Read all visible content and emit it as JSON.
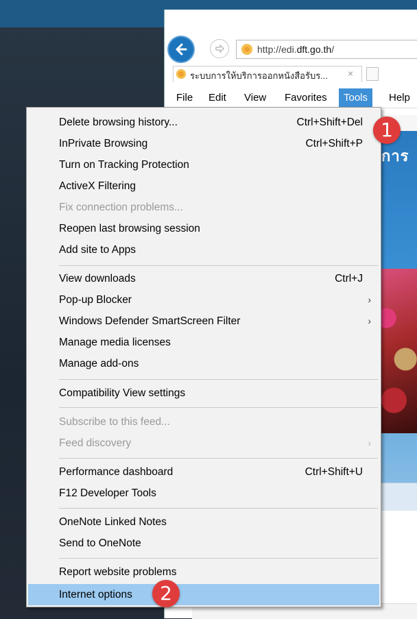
{
  "browser": {
    "url_prefix": "http://edi.",
    "url_domain": "dft.go.th",
    "url_suffix": "/",
    "tab_title": "ระบบการให้บริการออกหนังสือรับร...",
    "tab_close": "×"
  },
  "menubar": {
    "items": [
      "File",
      "Edit",
      "View",
      "Favorites",
      "Tools",
      "Help"
    ],
    "active": "Tools"
  },
  "page": {
    "banner_text": "การ"
  },
  "tools_menu": {
    "items": [
      {
        "label": "Delete browsing history...",
        "shortcut": "Ctrl+Shift+Del"
      },
      {
        "label": "InPrivate Browsing",
        "shortcut": "Ctrl+Shift+P"
      },
      {
        "label": "Turn on Tracking Protection"
      },
      {
        "label": "ActiveX Filtering"
      },
      {
        "label": "Fix connection problems...",
        "disabled": true
      },
      {
        "label": "Reopen last browsing session"
      },
      {
        "label": "Add site to Apps"
      },
      {
        "label": "View downloads",
        "shortcut": "Ctrl+J"
      },
      {
        "label": "Pop-up Blocker",
        "submenu": true
      },
      {
        "label": "Windows Defender SmartScreen Filter",
        "submenu": true
      },
      {
        "label": "Manage media licenses"
      },
      {
        "label": "Manage add-ons"
      },
      {
        "label": "Compatibility View settings"
      },
      {
        "label": "Subscribe to this feed...",
        "disabled": true
      },
      {
        "label": "Feed discovery",
        "disabled": true,
        "submenu": true
      },
      {
        "label": "Performance dashboard",
        "shortcut": "Ctrl+Shift+U"
      },
      {
        "label": "F12 Developer Tools"
      },
      {
        "label": "OneNote Linked Notes"
      },
      {
        "label": "Send to OneNote"
      },
      {
        "label": "Report website problems"
      },
      {
        "label": "Internet options",
        "selected": true
      }
    ],
    "submenu_arrow": "›"
  },
  "annotations": {
    "step1": "1",
    "step2": "2",
    "color": "#e03c3c"
  },
  "colors": {
    "menu_bg": "#f2f2f2",
    "highlight": "#9ccaf0",
    "tools_active": "#3d8fd6",
    "back_button": "#1c75bc"
  },
  "icons": {
    "back": "back-arrow-icon",
    "forward": "forward-arrow-icon",
    "site": "site-favicon-icon",
    "new_tab": "new-tab-icon"
  }
}
